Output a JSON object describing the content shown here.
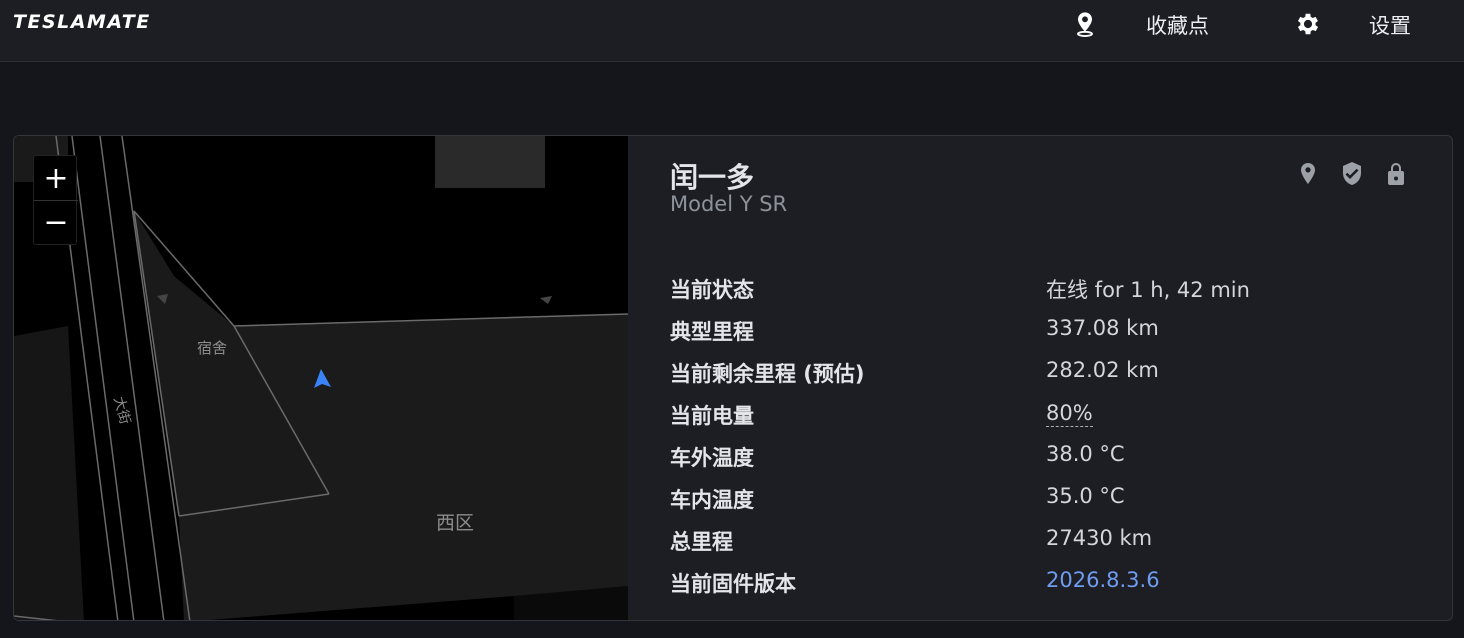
{
  "navbar": {
    "brand": "TESLAMATE",
    "items": [
      {
        "label": "收藏点",
        "icon": "map-pin-icon"
      },
      {
        "label": "设置",
        "icon": "gear-icon"
      }
    ]
  },
  "map": {
    "zoom_in": "+",
    "zoom_out": "−",
    "labels": [
      "宿舍",
      "大街",
      "西区"
    ]
  },
  "car": {
    "name": "闰一多",
    "model": "Model Y SR",
    "status_icons": [
      "location-icon",
      "shield-check-icon",
      "lock-icon"
    ],
    "rows": [
      {
        "label": "当前状态",
        "value": "在线 for 1 h, 42 min"
      },
      {
        "label": "典型里程",
        "value": "337.08 km"
      },
      {
        "label": "当前剩余里程 (预估)",
        "value": "282.02 km"
      },
      {
        "label": "当前电量",
        "value": "80%"
      },
      {
        "label": "车外温度",
        "value": "38.0 °C"
      },
      {
        "label": "车内温度",
        "value": "35.0 °C"
      },
      {
        "label": "总里程",
        "value": "27430 km"
      },
      {
        "label": "当前固件版本",
        "value": "2026.8.3.6"
      }
    ]
  },
  "colors": {
    "background": "#15161b",
    "card": "#1c1e23",
    "link": "#6f9cf0",
    "car_marker": "#3b82f6"
  }
}
